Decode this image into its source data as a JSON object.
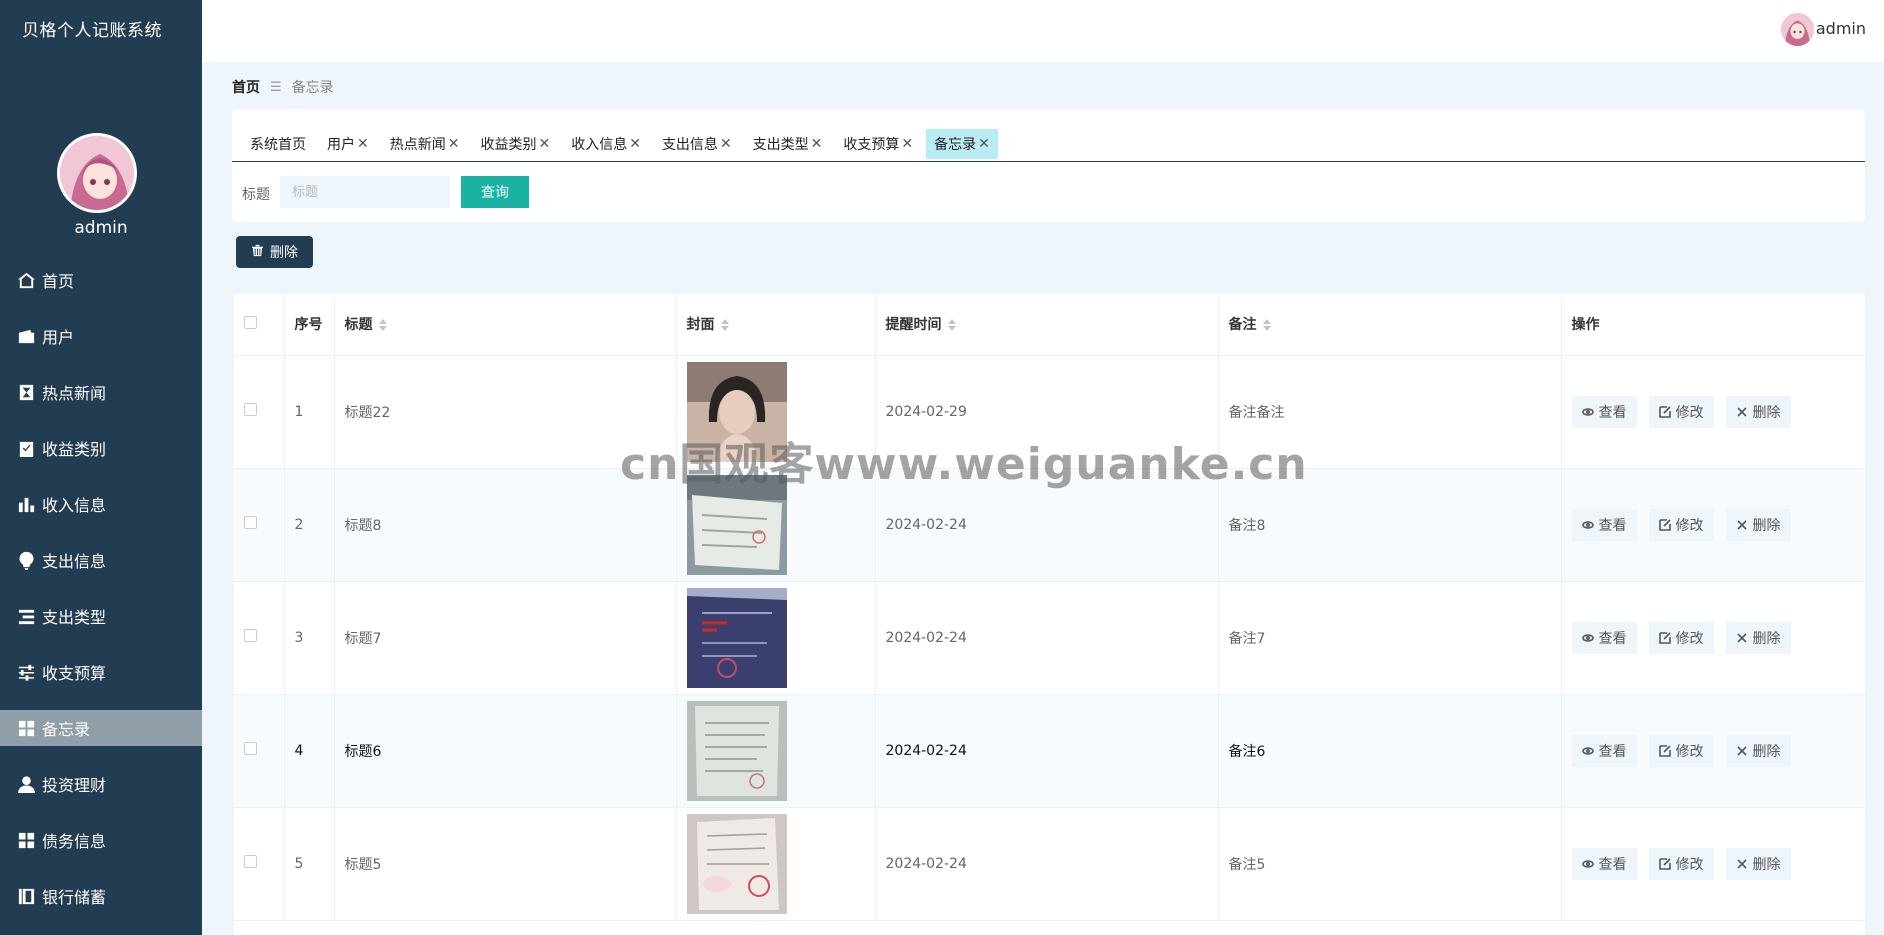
{
  "app": {
    "title": "贝格个人记账系统"
  },
  "sidebar": {
    "username": "admin",
    "items": [
      {
        "label": "首页",
        "icon": "home-icon"
      },
      {
        "label": "用户",
        "icon": "wallet-icon"
      },
      {
        "label": "热点新闻",
        "icon": "hourglass-icon"
      },
      {
        "label": "收益类别",
        "icon": "clipboard-check-icon"
      },
      {
        "label": "收入信息",
        "icon": "bar-chart-icon"
      },
      {
        "label": "支出信息",
        "icon": "lightbulb-icon"
      },
      {
        "label": "支出类型",
        "icon": "list-icon"
      },
      {
        "label": "收支预算",
        "icon": "sliders-icon"
      },
      {
        "label": "备忘录",
        "icon": "grid-icon",
        "active": true
      },
      {
        "label": "投资理财",
        "icon": "user-icon"
      },
      {
        "label": "债务信息",
        "icon": "grid-icon"
      },
      {
        "label": "银行储蓄",
        "icon": "book-icon"
      }
    ]
  },
  "header": {
    "username": "admin"
  },
  "breadcrumb": {
    "home": "首页",
    "separator": "☰",
    "current": "备忘录"
  },
  "tabs": [
    {
      "label": "系统首页",
      "closable": false
    },
    {
      "label": "用户",
      "closable": true
    },
    {
      "label": "热点新闻",
      "closable": true
    },
    {
      "label": "收益类别",
      "closable": true
    },
    {
      "label": "收入信息",
      "closable": true
    },
    {
      "label": "支出信息",
      "closable": true
    },
    {
      "label": "支出类型",
      "closable": true
    },
    {
      "label": "收支预算",
      "closable": true
    },
    {
      "label": "备忘录",
      "closable": true,
      "active": true
    }
  ],
  "search": {
    "label": "标题",
    "placeholder": "标题",
    "button": "查询"
  },
  "toolbar": {
    "delete_label": "删除"
  },
  "table": {
    "columns": [
      "序号",
      "标题",
      "封面",
      "提醒时间",
      "备注",
      "操作"
    ],
    "rows": [
      {
        "index": "1",
        "title": "标题22",
        "date": "2024-02-29",
        "note": "备注备注",
        "cover": "portrait"
      },
      {
        "index": "2",
        "title": "标题8",
        "date": "2024-02-24",
        "note": "备注8",
        "cover": "document"
      },
      {
        "index": "3",
        "title": "标题7",
        "date": "2024-02-24",
        "note": "备注7",
        "cover": "document-blue"
      },
      {
        "index": "4",
        "title": "标题6",
        "date": "2024-02-24",
        "note": "备注6",
        "cover": "document-gray"
      },
      {
        "index": "5",
        "title": "标题5",
        "date": "2024-02-24",
        "note": "备注5",
        "cover": "document-pink"
      }
    ],
    "actions": {
      "view": "查看",
      "edit": "修改",
      "delete": "删除"
    }
  },
  "watermark": "cn国观客www.weiguanke.cn",
  "colors": {
    "sidebar": "#223d52",
    "accent": "#1ab3a3",
    "active_tab": "#b9ecf4",
    "active_menu": "#8f9ea8"
  }
}
